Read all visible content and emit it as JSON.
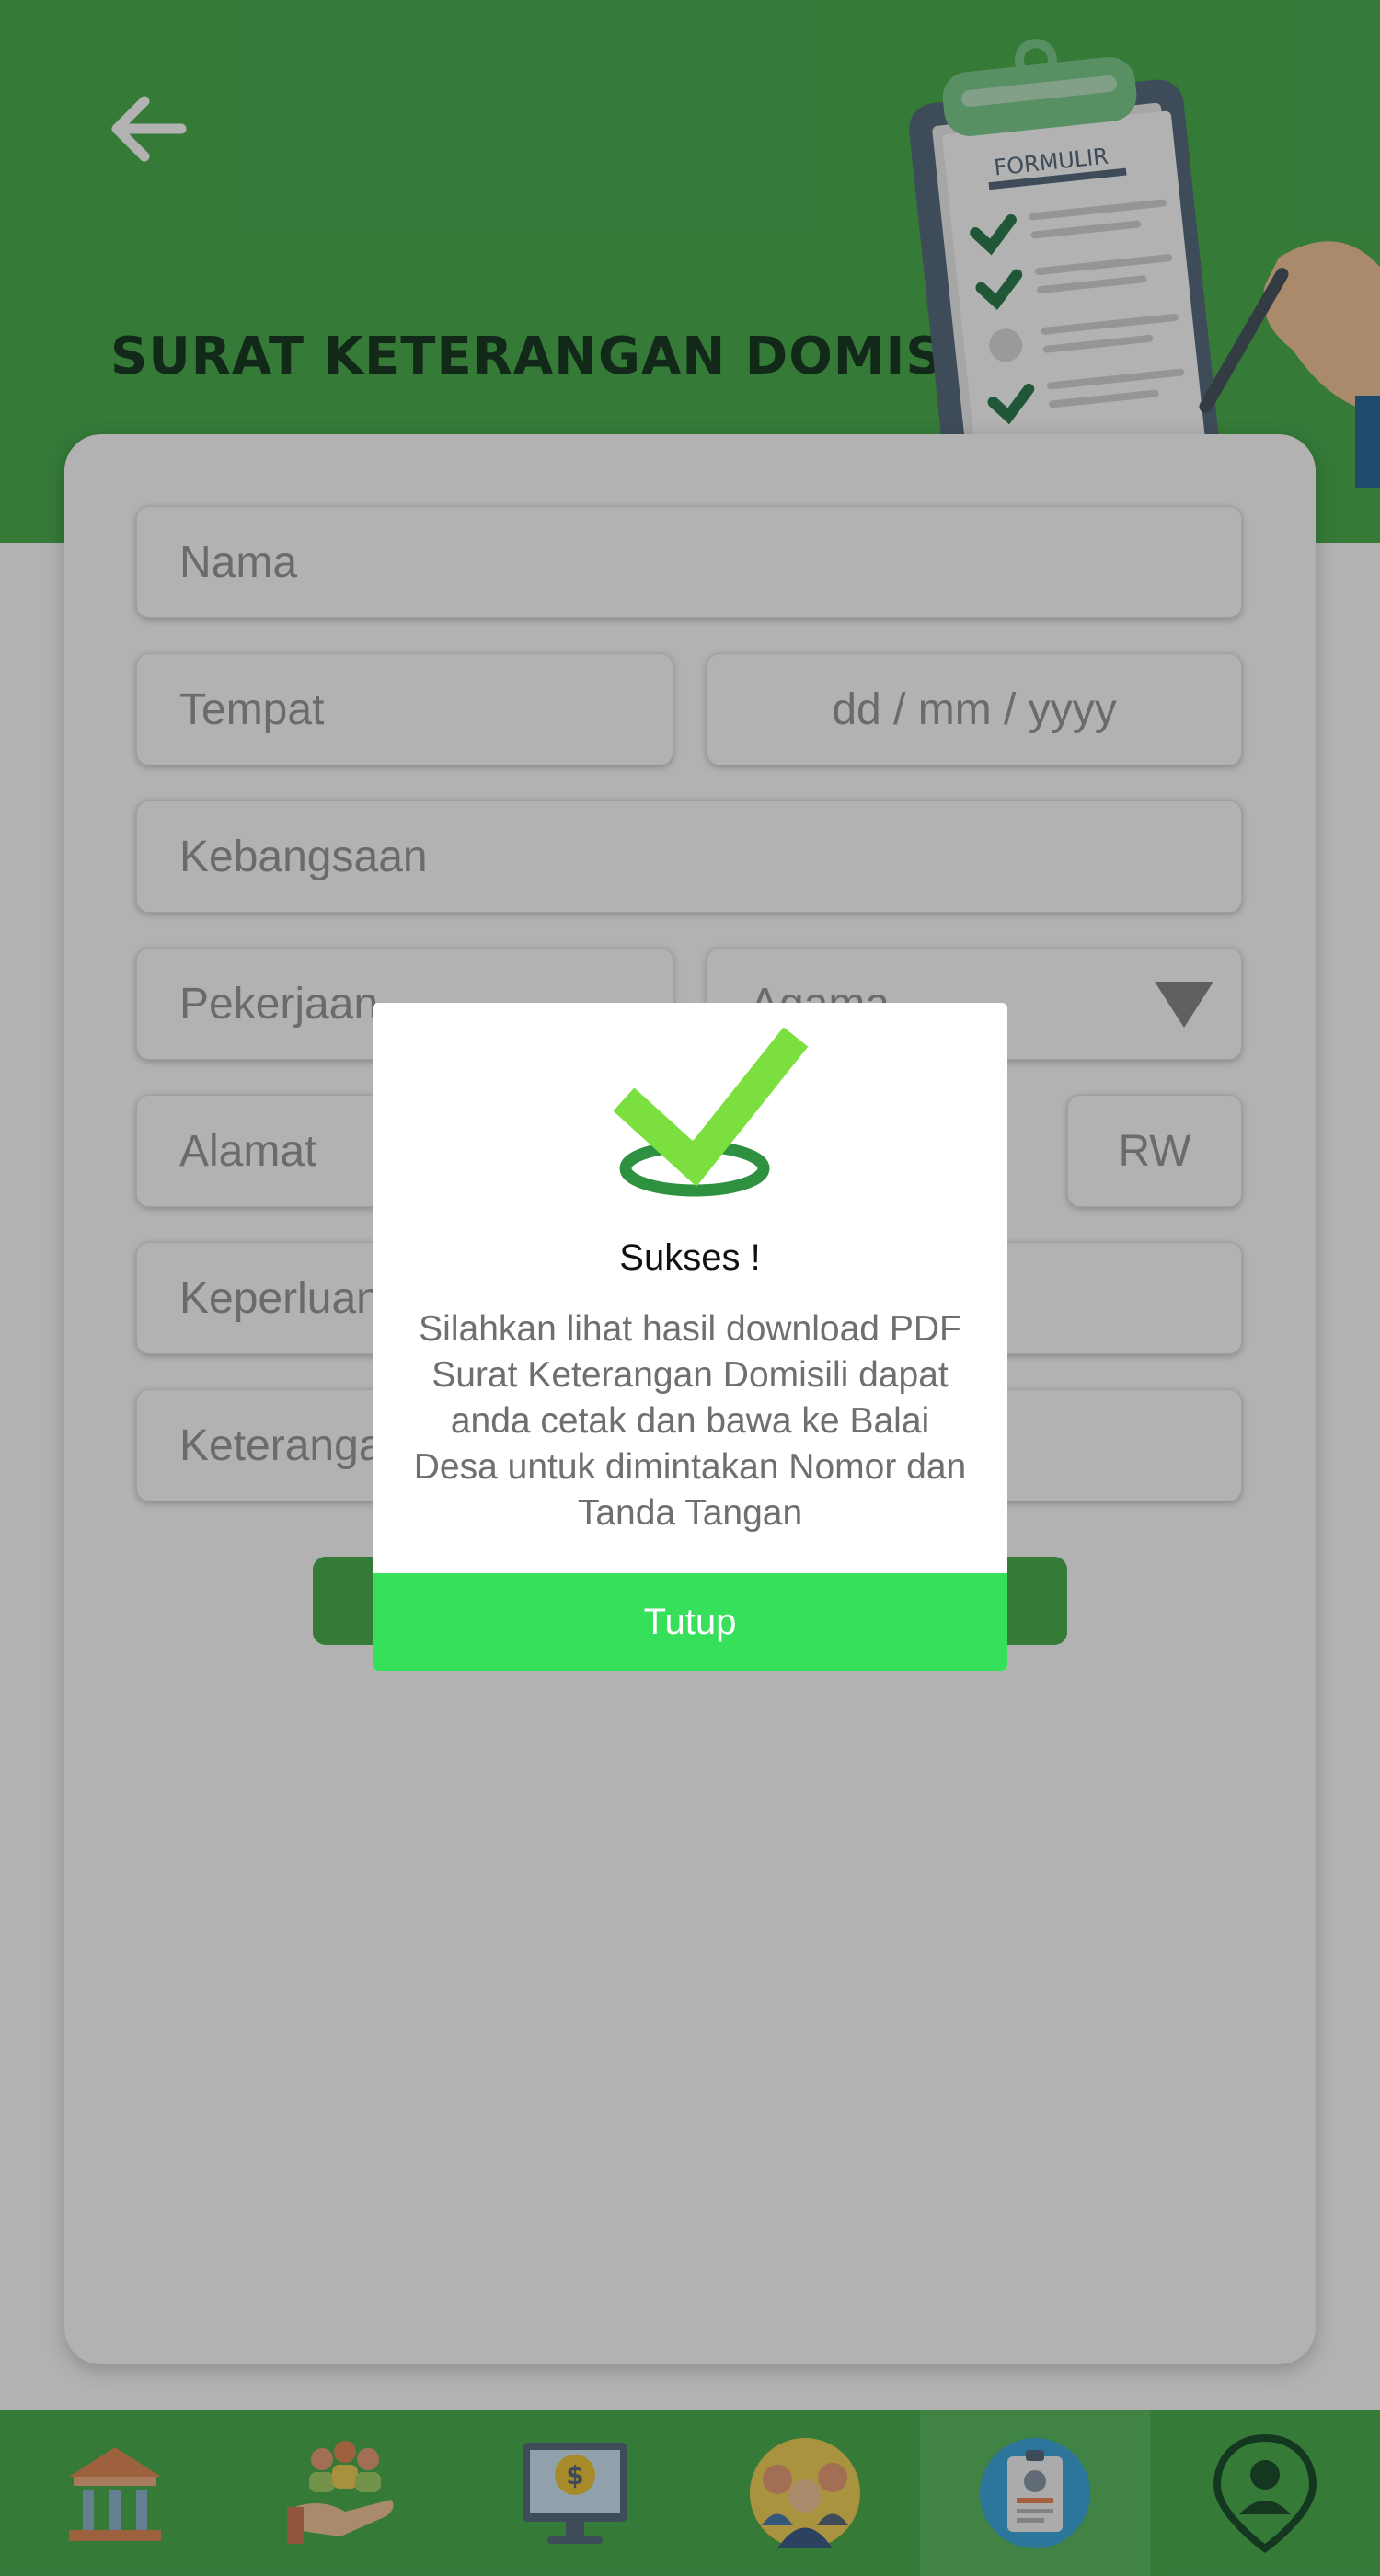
{
  "header": {
    "title": "SURAT KETERANGAN DOMISILI",
    "illustration_label": "FORMULIR",
    "color": "#4caf50"
  },
  "form": {
    "nama_placeholder": "Nama",
    "tempat_placeholder": "Tempat",
    "tanggal_placeholder": "dd / mm / yyyy",
    "kebangsaan_placeholder": "Kebangsaan",
    "pekerjaan_placeholder": "Pekerjaan",
    "agama_placeholder": "Agama",
    "alamat_placeholder": "Alamat",
    "rw_placeholder": "RW",
    "keperluan_placeholder": "Keperluan",
    "keterangan_placeholder": "Keterangan"
  },
  "dialog": {
    "title": "Sukses !",
    "message": "Silahkan lihat hasil download PDF Surat Keterangan Domisili dapat anda cetak dan bawa ke Balai Desa untuk dimintakan Nomor dan Tanda Tangan",
    "close_label": "Tutup",
    "button_color": "#37e05a"
  },
  "bottom_nav": {
    "items": [
      "bank-icon",
      "community-icon",
      "finance-monitor-icon",
      "people-icon",
      "id-card-icon",
      "location-person-icon"
    ],
    "active": "id-card-icon"
  }
}
